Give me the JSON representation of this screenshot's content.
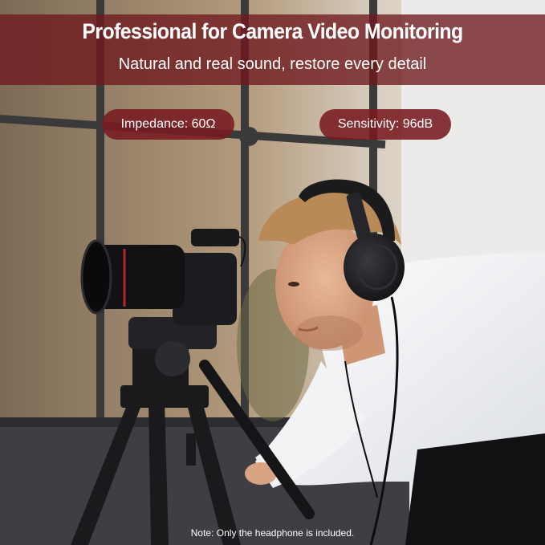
{
  "header": {
    "title": "Professional for Camera Video Monitoring",
    "subtitle": "Natural and real sound, restore every detail"
  },
  "specs": [
    {
      "label": "Impedance: 60Ω"
    },
    {
      "label": "Sensitivity: 96dB"
    }
  ],
  "footer": {
    "note": "Note: Only the headphone is included."
  },
  "colors": {
    "banner": "#6e181e",
    "pill": "#781a20",
    "text": "#ffffff"
  }
}
